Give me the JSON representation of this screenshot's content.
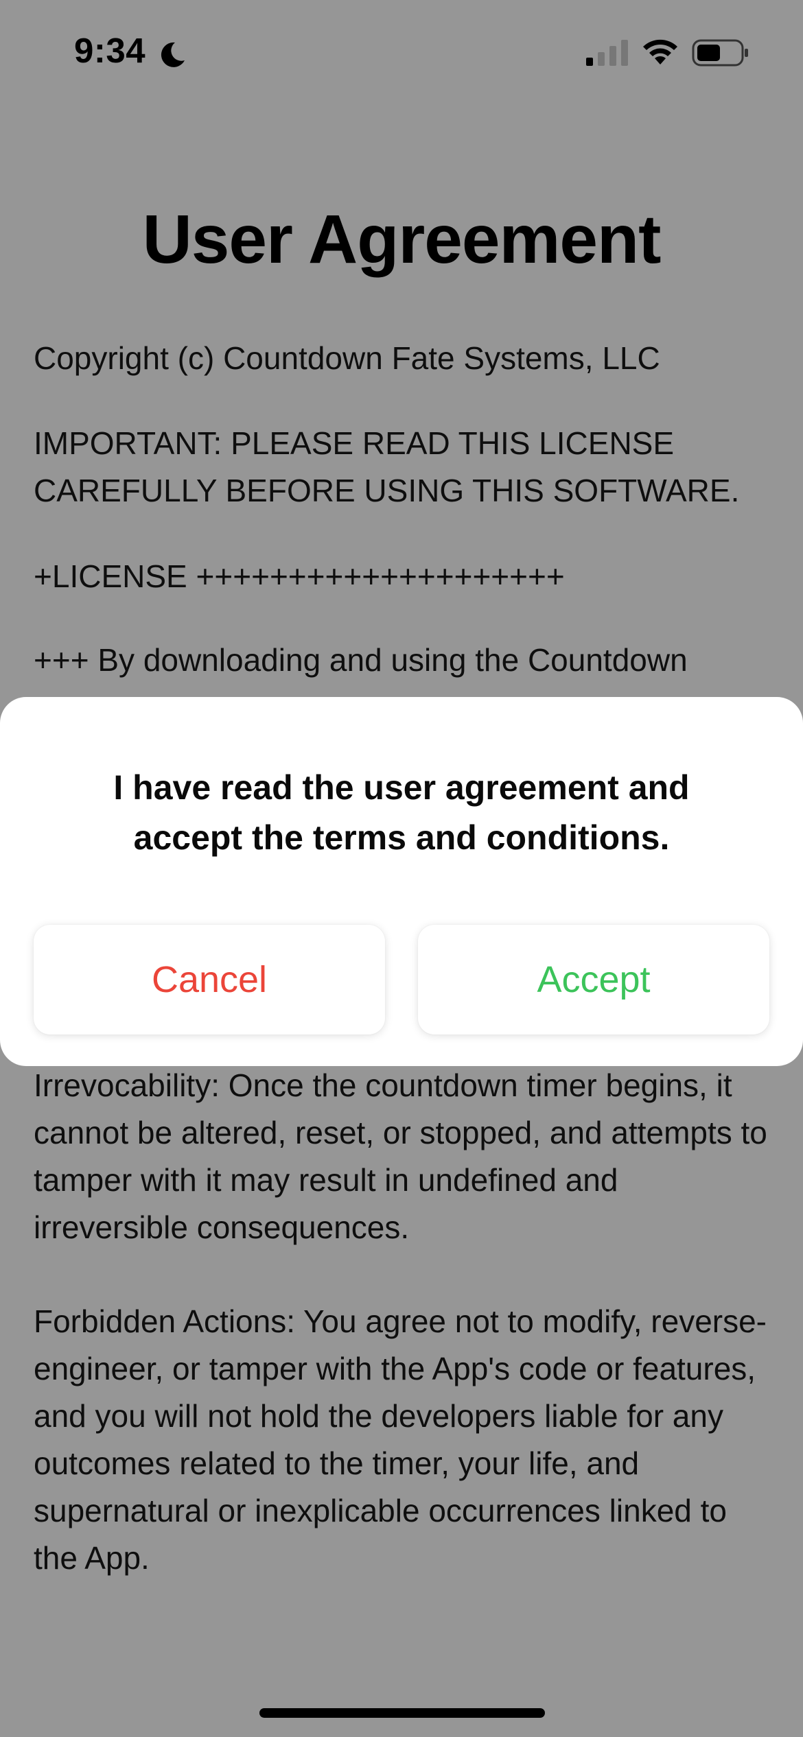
{
  "status_bar": {
    "time": "9:34",
    "focus_icon": "moon-icon",
    "signal_icon": "cellular-signal-icon",
    "wifi_icon": "wifi-icon",
    "battery_icon": "battery-icon"
  },
  "page": {
    "title": "User Agreement",
    "paragraphs": [
      "Copyright (c) Countdown Fate Systems, LLC",
      "IMPORTANT: PLEASE READ THIS LICENSE CAREFULLY BEFORE USING THIS SOFTWARE.",
      "+LICENSE ++++++++++++++++++++",
      "+++ By downloading and using the Countdown",
      "Irrevocability: Once the countdown timer begins, it cannot be altered, reset, or stopped, and attempts to tamper with it may result in undefined and irreversible consequences.",
      "Forbidden Actions: You agree not to modify, reverse-engineer, or tamper with the App's code or features, and you will not hold the developers liable for any outcomes related to the timer, your life, and supernatural or inexplicable occurrences linked to the App."
    ]
  },
  "dialog": {
    "message": "I have read the user agreement and accept the terms and conditions.",
    "cancel_label": "Cancel",
    "accept_label": "Accept",
    "colors": {
      "cancel": "#eb4539",
      "accept": "#3cc35a"
    }
  },
  "colors": {
    "dimmed_background": "#969696",
    "dialog_background": "#ffffff"
  }
}
